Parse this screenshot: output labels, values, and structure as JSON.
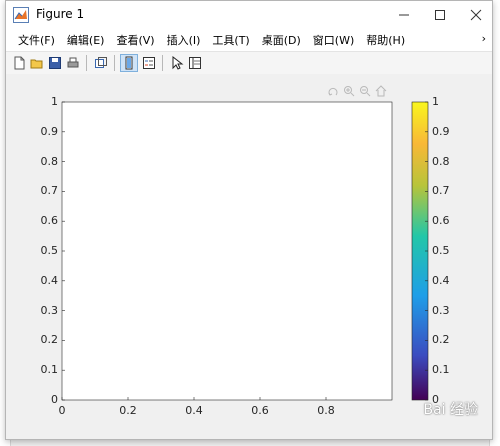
{
  "window": {
    "title": "Figure 1",
    "app_icon": "matlab-logo-icon"
  },
  "titlebar": {
    "minimize_icon": "minimize-icon",
    "maximize_icon": "maximize-icon",
    "close_icon": "close-icon"
  },
  "menu": {
    "items": [
      "文件(F)",
      "编辑(E)",
      "查看(V)",
      "插入(I)",
      "工具(T)",
      "桌面(D)",
      "窗口(W)",
      "帮助(H)"
    ],
    "overflow": "›"
  },
  "toolbar": {
    "buttons": [
      "new-figure-icon",
      "open-file-icon",
      "save-icon",
      "print-icon",
      "link-plot-icon",
      "insert-colorbar-icon",
      "insert-legend-icon",
      "edit-plot-icon",
      "property-inspector-icon"
    ]
  },
  "axes_toolbar": [
    "rotate-icon",
    "zoom-in-icon",
    "zoom-out-icon",
    "home-icon"
  ],
  "colors": {
    "axes_bg": "#ffffff",
    "colormap": [
      "#440154",
      "#3b4cc0",
      "#1f9ee8",
      "#22c7a8",
      "#b8c43a",
      "#f8b838",
      "#f9f61e"
    ]
  },
  "chart_data": {
    "type": "scatter",
    "title": "",
    "xlabel": "",
    "ylabel": "",
    "xlim": [
      0,
      1
    ],
    "ylim": [
      0,
      1
    ],
    "x_ticks": [
      "0",
      "0.2",
      "0.4",
      "0.6",
      "0.8"
    ],
    "y_ticks": [
      "0",
      "0.1",
      "0.2",
      "0.3",
      "0.4",
      "0.5",
      "0.6",
      "0.7",
      "0.8",
      "0.9",
      "1"
    ],
    "series": [],
    "grid": false,
    "colorbar": {
      "range": [
        0,
        1
      ],
      "ticks": [
        "0",
        "0.1",
        "0.2",
        "0.3",
        "0.4",
        "0.5",
        "0.6",
        "0.7",
        "0.8",
        "0.9",
        "1"
      ]
    }
  },
  "watermark": "Bai 经验"
}
